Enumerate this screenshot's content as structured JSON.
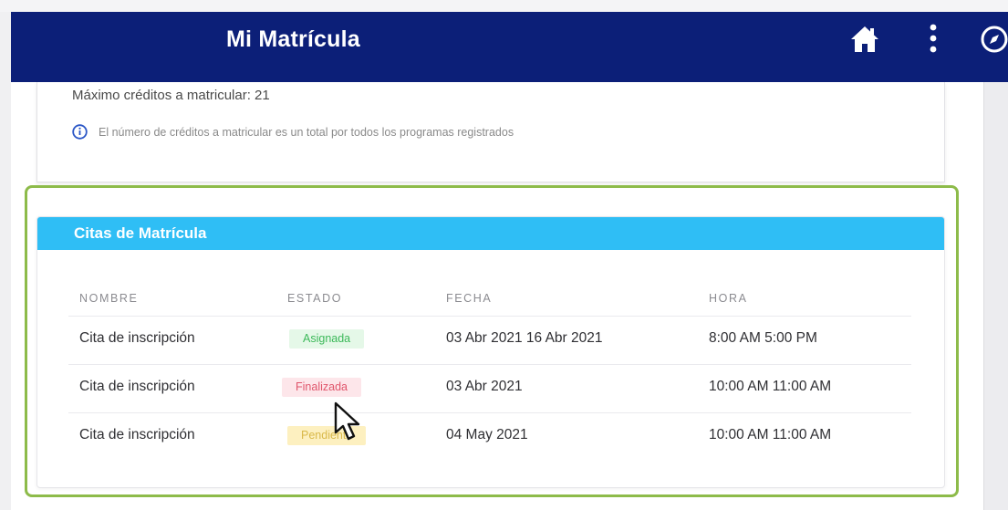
{
  "header": {
    "title": "Mi Matrícula",
    "icons": [
      "home-icon",
      "more-vertical-icon",
      "compass-icon"
    ],
    "background_color": "#0c1f78"
  },
  "credits": {
    "max_text": "Máximo créditos a matricular:  21",
    "info_text": "El número de créditos a matricular es un total por todos los programas registrados"
  },
  "citas": {
    "title": "Citas de Matrícula",
    "header_color": "#2fbef5",
    "columns": [
      "NOMBRE",
      "ESTADO",
      "FECHA",
      "HORA"
    ],
    "rows": [
      {
        "nombre": "Cita de inscripción",
        "estado": "Asignada",
        "fecha": "03 Abr 2021 16 Abr 2021",
        "hora": "8:00 AM 5:00 PM"
      },
      {
        "nombre": "Cita de inscripción",
        "estado": "Finalizada",
        "fecha": "03 Abr 2021",
        "hora": "10:00 AM 11:00 AM"
      },
      {
        "nombre": "Cita de inscripción",
        "estado": "Pendiente",
        "fecha": "04 May 2021",
        "hora": "10:00 AM 11:00 AM"
      }
    ]
  },
  "status_colors": {
    "asignada": "#3db95a",
    "finalizada": "#e0566c",
    "pendiente": "#d9b94a"
  },
  "highlight_color": "#8dbb4a"
}
